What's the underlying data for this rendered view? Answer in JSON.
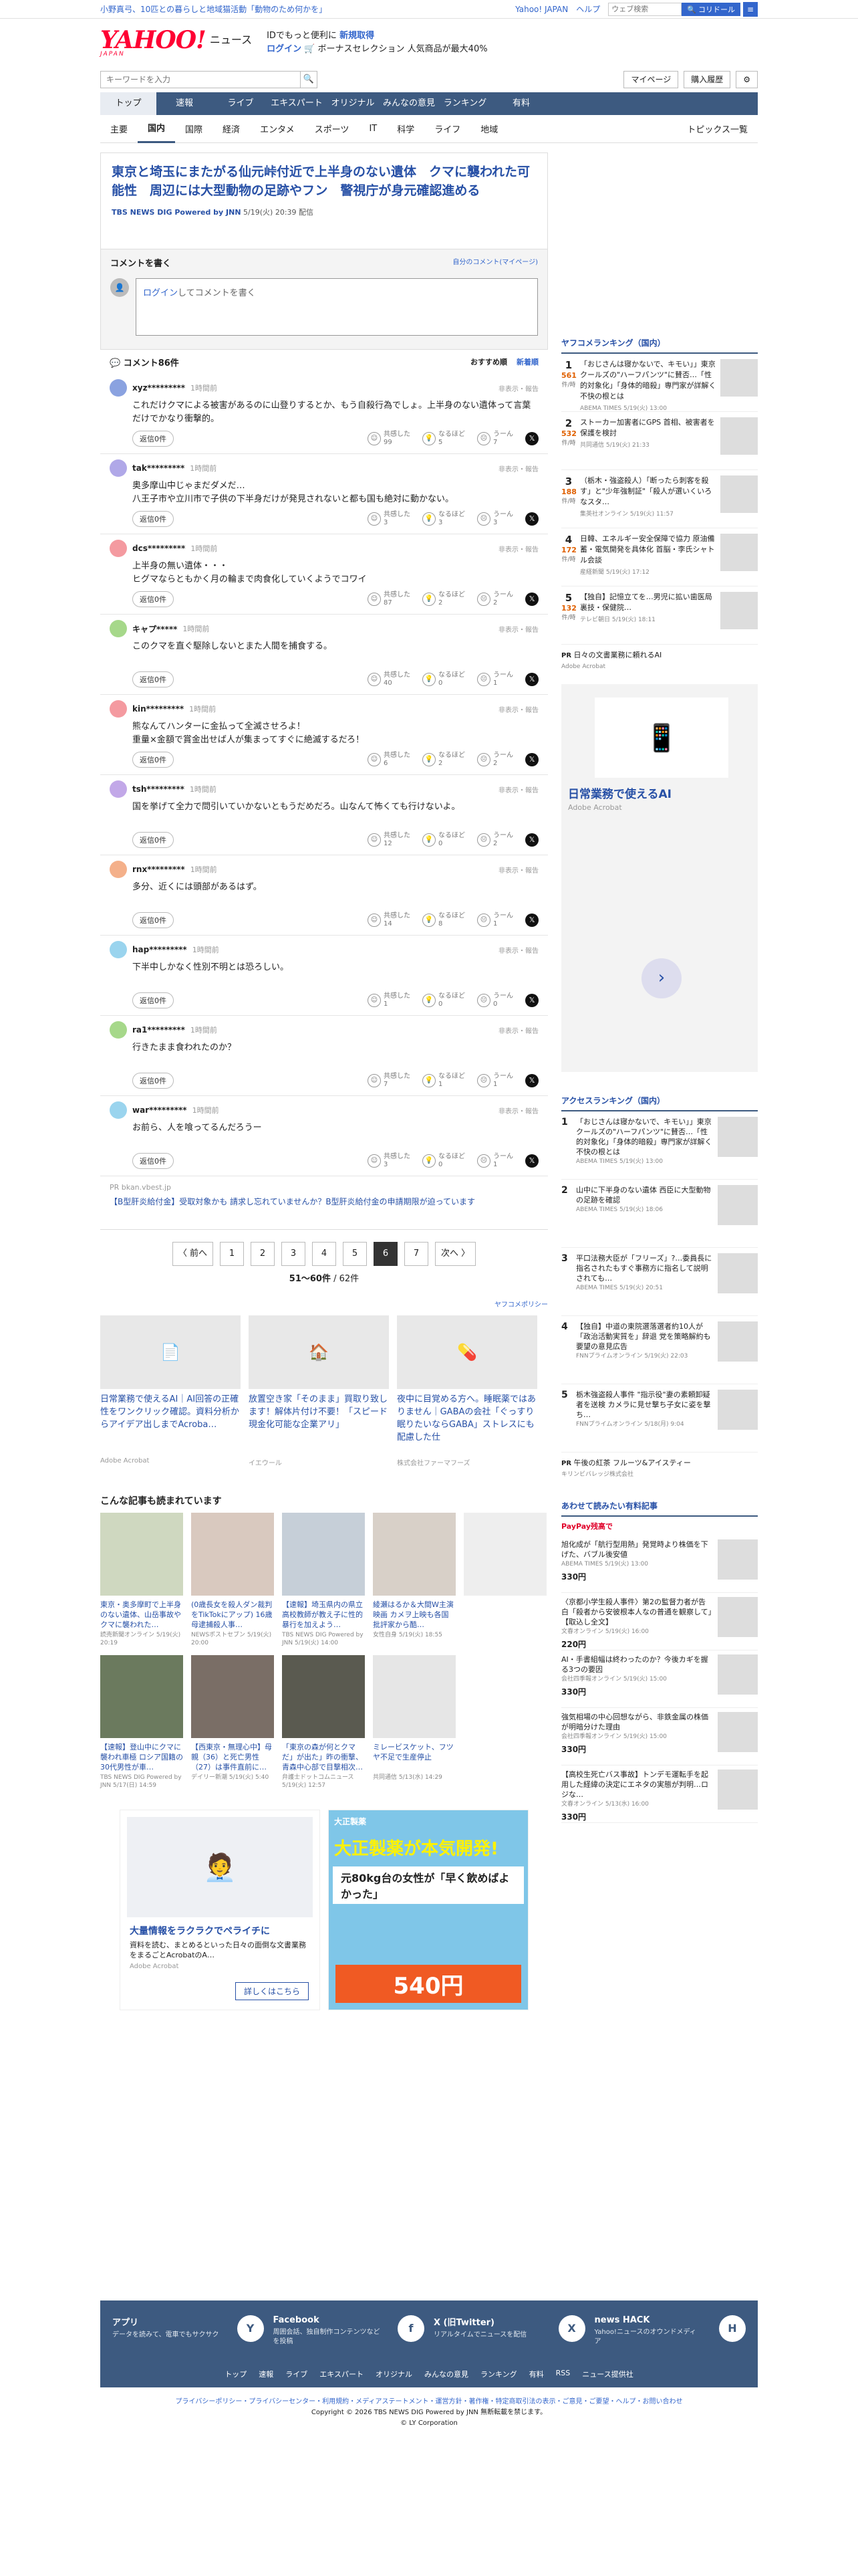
{
  "topbar": {
    "left": "小野真弓、10匹との暮らしと地域猫活動「動物のため何かを」",
    "links": [
      "Yahoo! JAPAN",
      "ヘルプ"
    ],
    "search_placeholder": "ウェブ検索",
    "search_btn": "🔍 コリドール"
  },
  "header": {
    "logo": "YAHOO!",
    "logo_sub": "JAPAN",
    "news": "ニュース",
    "promo1": "IDでもっと便利に",
    "promo1b": "新規取得",
    "promo2": "ログイン",
    "promo3": "🛒 ボーナスセレクション 人気商品が最大40%"
  },
  "search": {
    "placeholder": "キーワードを入力",
    "mypage": "マイページ",
    "history": "購入履歴"
  },
  "gnav": [
    "トップ",
    "速報",
    "ライブ",
    "エキスパート",
    "オリジナル",
    "みんなの意見",
    "ランキング",
    "有料"
  ],
  "subnav": [
    "主要",
    "国内",
    "国際",
    "経済",
    "エンタメ",
    "スポーツ",
    "IT",
    "科学",
    "ライフ",
    "地域"
  ],
  "subnav_right": "トピックス一覧",
  "article": {
    "title": "東京と埼玉にまたがる仙元峠付近で上半身のない遺体　クマに襲われた可能性　周辺には大型動物の足跡やフン　警視庁が身元確認進める",
    "source": "TBS NEWS DIG Powered by JNN",
    "date": "5/19(火) 20:39 配信"
  },
  "comment_write": {
    "title": "コメントを書く",
    "mine": "自分のコメント(マイページ)",
    "login": "ログイン",
    "placeholder": "してコメントを書く"
  },
  "comments_head": {
    "count": "コメント86件",
    "sort1": "おすすめ順",
    "sort2": "新着順"
  },
  "comments": [
    {
      "name": "xyz*********",
      "time": "1時間前",
      "color": "#8aa2e0",
      "text": "これだけクマによる被害があるのに山登りするとか、もう自殺行為でしょ。上半身のない遺体って言葉だけでかなり衝撃的。",
      "c": [
        "99",
        "5",
        "7"
      ]
    },
    {
      "name": "tak*********",
      "time": "1時間前",
      "color": "#b0a8e8",
      "text": "奥多摩山中じゃまだダメだ…\n八王子市や立川市で子供の下半身だけが発見されないと都も国も絶対に動かない。",
      "c": [
        "3",
        "3",
        "3"
      ]
    },
    {
      "name": "dcs*********",
      "time": "1時間前",
      "color": "#f49aa0",
      "text": "上半身の無い遺体・・・\nヒグマならともかく月の輪まで肉食化していくようでコワイ",
      "c": [
        "87",
        "2",
        "2"
      ]
    },
    {
      "name": "キャプ*****",
      "time": "1時間前",
      "color": "#a6d88a",
      "text": "このクマを直ぐ駆除しないとまた人間を捕食する。",
      "c": [
        "40",
        "0",
        "1"
      ]
    },
    {
      "name": "kin*********",
      "time": "1時間前",
      "color": "#f49aa0",
      "text": "熊なんてハンターに金払って全滅させろよ！\n重量×金額で賞金出せば人が集まってすぐに絶滅するだろ！",
      "c": [
        "6",
        "2",
        "2"
      ]
    },
    {
      "name": "tsh*********",
      "time": "1時間前",
      "color": "#c2a8e8",
      "text": "国を挙げて全力で問引いていかないともうだめだろ。山なんて怖くても行けないよ。",
      "c": [
        "12",
        "0",
        "2"
      ]
    },
    {
      "name": "rnx*********",
      "time": "1時間前",
      "color": "#f4b08a",
      "text": "多分、近くには頭部があるはず。",
      "c": [
        "14",
        "8",
        "1"
      ]
    },
    {
      "name": "hap*********",
      "time": "1時間前",
      "color": "#9ad4ee",
      "text": "下半中しかなく性別不明とは恐ろしい。",
      "c": [
        "1",
        "0",
        "0"
      ]
    },
    {
      "name": "ra1*********",
      "time": "1時間前",
      "color": "#a6d88a",
      "text": "行きたまま食われたのか？",
      "c": [
        "7",
        "1",
        "1"
      ]
    },
    {
      "name": "war*********",
      "time": "1時間前",
      "color": "#9ad4ee",
      "text": "お前ら、人を喰ってるんだろうー",
      "c": [
        "3",
        "0",
        "1"
      ]
    }
  ],
  "comment_labels": {
    "reply": "返信0件",
    "r1": "共感した",
    "r2": "なるほど",
    "r3": "うーん",
    "report": "非表示・報告"
  },
  "pr_comment": {
    "source": "bkan.vbest.jp",
    "title": "【B型肝炎給付金】受取対象かも 請求し忘れていませんか？B型肝炎給付金の申請期限が迫っています"
  },
  "pager": {
    "prev": "〈 前へ",
    "pages": [
      "1",
      "2",
      "3",
      "4",
      "5",
      "6",
      "7"
    ],
    "current": "6",
    "next": "次へ 〉",
    "range": "51〜60件",
    "total": "/ 62件",
    "policy": "ヤフコメポリシー"
  },
  "ads3": [
    {
      "title": "日常業務で使えるAI｜AI回答の正確性をワンクリック確認。資料分析からアイデア出しまでAcroba…",
      "src": "Adobe Acrobat"
    },
    {
      "title": "放置空き家「そのまま」買取り致します！解体片付け不要！「スピード現金化可能な企業アリ」",
      "src": "イエウール"
    },
    {
      "title": "夜中に目覚める方へ。睡眠薬ではありません｜GABAの会社「ぐっすり眠りたいならGABA」ストレスにも配慮した仕",
      "src": "株式会社ファーマフーズ"
    }
  ],
  "also": {
    "title": "こんな記事も読まれています",
    "items": [
      {
        "t": "東京・奥多摩町で上半身のない遺体、山岳事故やクマに襲われた…",
        "s": "読売新聞オンライン 5/19(火) 20:19"
      },
      {
        "t": "(0歳長女を殺人ダン裁判をTikTokにアップ) 16歳母逮捕殺人事…",
        "s": "NEWSポストセブン 5/19(火) 20:00"
      },
      {
        "t": "【速報】埼玉県内の県立高校教師が教え子に性的暴行を加えよう…",
        "s": "TBS NEWS DIG Powered by JNN 5/19(火) 14:00"
      },
      {
        "t": "綾瀬はるか＆大間W主演映画 カメヲ上映も各国批評家から酷…",
        "s": "女性自身 5/19(火) 18:55"
      },
      {
        "t": "",
        "s": ""
      },
      {
        "t": "【速報】登山中にクマに襲われ車極 ロシア国籍の30代男性が車…",
        "s": "TBS NEWS DIG Powered by JNN 5/17(日) 14:59"
      },
      {
        "t": "【西東京・無理心中】母親（36）と死亡男性（27）は事件直前に…",
        "s": "デイリー新潮 5/19(火) 5:40"
      },
      {
        "t": "「東京の森が何とクマだ」が出た」昨の衝撃、青森中心部で目撃相次…",
        "s": "弁護士ドットコムニュース 5/19(火) 12:57"
      },
      {
        "t": "ミレービスケット、フツヤ不足で生産停止",
        "s": "共同通信 5/13(水) 14:29"
      }
    ]
  },
  "bigads": {
    "left_title": "大量情報をラクラクでペライチに",
    "left_sub": "資料を読む、まとめるといった日々の面倒な文書業務をまるごとAcrobatのA…",
    "left_src": "Adobe Acrobat",
    "left_more": "詳しくはこちら",
    "right_brand": "大正製薬",
    "right_head": "大正製薬が本気開発!",
    "right_text": "元80kg台の女性が「早く飲めばよかった」",
    "right_price": "540円"
  },
  "ranking": {
    "title": "ヤフコメランキング（国内）",
    "items": [
      {
        "n": "1",
        "c": "561",
        "t": "「おじさんは寝かないで、キモい」」東京クールズの\"ハーフパンツ\"に賛否…「性的対象化」「身体的暗殺」専門家が詳解く不快の根とは",
        "m": "ABEMA TIMES 5/19(火) 13:00"
      },
      {
        "n": "2",
        "c": "532",
        "t": "ストーカー加害者にGPS 首相、被害者を保護を検討",
        "m": "共同通信 5/19(火) 21:33"
      },
      {
        "n": "3",
        "c": "188",
        "t": "（栃木・強盗殺人）「断ったら刺客を殺す」と\"少年強制証\"「殺人が選いくいろなスタ…",
        "m": "集英社オンライン 5/19(火) 11:57"
      },
      {
        "n": "4",
        "c": "172",
        "t": "日韓、エネルギー安全保障で協力 原油備蓄・電気開発を具体化 首脳・李氏シャトル会談",
        "m": "産経新聞 5/19(火) 17:12"
      },
      {
        "n": "5",
        "c": "132",
        "t": "【独自】記憶立てを…男児に拡い歯医局 裏技・保健院…",
        "m": "テレビ朝日 5/19(火) 18:11"
      }
    ],
    "pr": {
      "t": "日々の文書業務に頼れるAI",
      "s": "Adobe Acrobat"
    }
  },
  "sidead": {
    "title": "日常業務で使えるAI",
    "src": "Adobe Acrobat"
  },
  "access": {
    "title": "アクセスランキング（国内）",
    "items": [
      {
        "n": "1",
        "t": "「おじさんは寝かないで、キモい」」東京クールズの\"ハーフパンツ\"に賛否…「性的対象化」「身体的暗殺」専門家が詳解く不快の根とは",
        "m": "ABEMA TIMES 5/19(火) 13:00"
      },
      {
        "n": "2",
        "t": "山中に下半身のない遺体 西臣に大型動物の足跡を確認",
        "m": "ABEMA TIMES 5/19(火) 18:06"
      },
      {
        "n": "3",
        "t": "平口法務大臣が「フリーズ」?…委員長に指名されたもすぐ事務方に指名して説明されても…",
        "m": "ABEMA TIMES 5/19(火) 20:51"
      },
      {
        "n": "4",
        "t": "【独自】中道の東院選落選者約10人が「政治活動実質を」辞退 党を策略解約も要望の意見広告",
        "m": "FNNプライムオンライン 5/19(火) 22:03"
      },
      {
        "n": "5",
        "t": "栃木強盗殺人事件 \"指示役\"妻の素頼卸疑者を送検 カメラに見せ撃ち子女に姿を撃ち…",
        "m": "FNNプライムオンライン 5/18(月) 9:04"
      }
    ],
    "pr": {
      "t": "午後の紅茶 フルーツ&アイスティー",
      "s": "キリンビバレッジ株式会社"
    }
  },
  "paid": {
    "title": "あわせて読みたい有料記事",
    "brand": "PayPay残高で",
    "items": [
      {
        "t": "旭化成が「航行型用熱」発覚時より株価を下げた、バブル後安値",
        "m": "ABEMA TIMES 5/19(火) 13:00",
        "p": "330円"
      },
      {
        "t": "〈京都小学生殺人事件〉第2の監督力者が告白「殺者から安彼根本人なの普通を観察して」【取込し全文】",
        "m": "文春オンライン 5/19(火) 16:00",
        "p": "220円"
      },
      {
        "t": "AI・手書組幅は終わったのか？今後カギを握る3つの要因",
        "m": "会社四季報オンライン 5/19(火) 15:00",
        "p": "330円"
      },
      {
        "t": "強気相場の中心回想ながら、非鉄金属の株価が明暗分けた理由",
        "m": "会社四季報オンライン 5/19(火) 15:00",
        "p": "330円"
      },
      {
        "t": "【高校生死亡バス事故】トンデモ運転手を起用した経緯の決定にエネタの実態が判明…ロジな…",
        "m": "文春オンライン 5/13(水) 16:00",
        "p": "330円"
      }
    ]
  },
  "footer": {
    "cols": [
      {
        "t": "アプリ",
        "d": "データを読みて、電車でもサクサク",
        "i": "Y"
      },
      {
        "t": "Facebook",
        "d": "周囲会話、独自制作コンテンツなどを投稿",
        "i": "f"
      },
      {
        "t": "X (旧Twitter)",
        "d": "リアルタイムでニュースを配信",
        "i": "X"
      },
      {
        "t": "news HACK",
        "d": "Yahoo!ニュースのオウンドメディア",
        "i": "H"
      }
    ],
    "links": [
      "トップ",
      "速報",
      "ライブ",
      "エキスパート",
      "オリジナル",
      "みんなの意見",
      "ランキング",
      "有料",
      "RSS",
      "ニュース提供社"
    ],
    "legal": "プライバシーポリシー・プライバシーセンター・利用規約・メディアステートメント・運営方針・著作権・特定商取引法の表示・ご意見・ご要望・ヘルプ・お問い合わせ",
    "copy1": "Copyright © 2026 TBS NEWS DIG Powered by JNN 無断転載を禁じます。",
    "copy2": "© LY Corporation"
  }
}
